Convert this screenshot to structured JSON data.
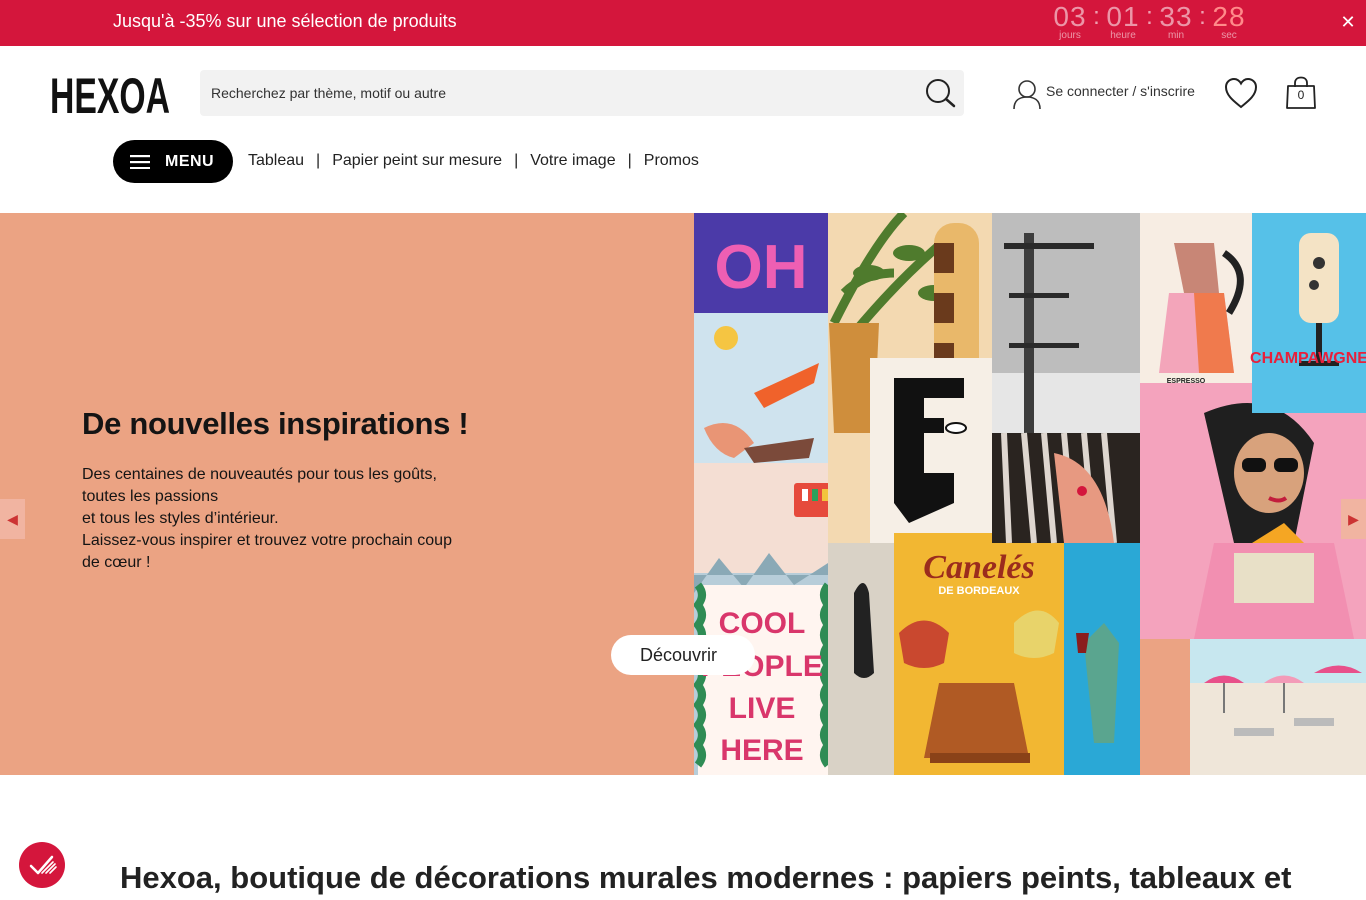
{
  "promo": {
    "text": "Jusqu'à -35% sur une sélection de produits",
    "countdown": [
      {
        "value": "03",
        "label": "jours"
      },
      {
        "value": "01",
        "label": "heure"
      },
      {
        "value": "33",
        "label": "min"
      },
      {
        "value": "28",
        "label": "sec"
      }
    ],
    "separator": ":",
    "close_label": "✕",
    "background": "#d4163c"
  },
  "header": {
    "logo_text": "HEXOA",
    "search_placeholder": "Recherchez par thème, motif ou autre",
    "account_label": "Se connecter / s'inscrire",
    "cart_count": "0"
  },
  "nav": {
    "menu_label": "MENU",
    "links": [
      "Tableau",
      "Papier peint sur mesure",
      "Votre image",
      "Promos"
    ],
    "separator": "|"
  },
  "hero": {
    "title": "De nouvelles inspirations !",
    "description_lines": [
      "Des centaines de nouveautés pour tous les goûts,",
      "toutes les passions",
      "et tous les styles d’intérieur.",
      "Laissez-vous inspirer et trouvez votre prochain coup",
      "de cœur !"
    ],
    "cta": "Découvrir",
    "collage_texts": {
      "oh": "OH",
      "espresso": "ESPRESSO",
      "champagne": "CHAMPAWGNE",
      "caneles": "Canelés",
      "caneles_sub": "DE BORDEAUX",
      "cool": "COOL",
      "people": "PEOPLE",
      "live": "LIVE",
      "here": "HERE"
    },
    "background": "#eba383"
  },
  "main": {
    "heading": "Hexoa, boutique de décorations murales modernes : papiers peints, tableaux et"
  }
}
